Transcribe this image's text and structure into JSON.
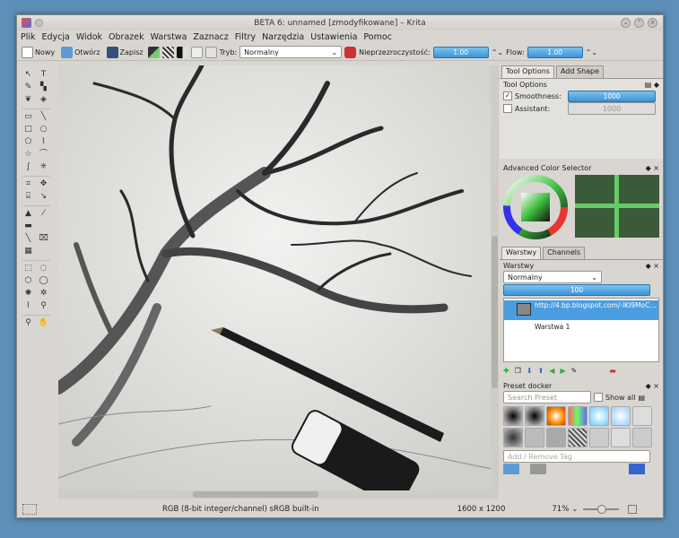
{
  "window": {
    "title": "BETA 6: unnamed [zmodyfikowane] – Krita"
  },
  "menu": [
    "Plik",
    "Edycja",
    "Widok",
    "Obrazek",
    "Warstwa",
    "Zaznacz",
    "Filtry",
    "Narzędzia",
    "Ustawienia",
    "Pomoc"
  ],
  "toolbar": {
    "new_label": "Nowy",
    "open_label": "Otwórz",
    "save_label": "Zapisz",
    "mode_label": "Tryb:",
    "mode_value": "Normalny",
    "opacity_label": "Nieprzezroczystość:",
    "opacity_value": "1.00",
    "flow_label": "Flow:",
    "flow_value": "1.00"
  },
  "tool_options": {
    "tab_active": "Tool Options",
    "tab_inactive": "Add Shape",
    "title": "Tool Options",
    "smoothness_label": "Smoothness:",
    "smoothness_value": "1000",
    "assistant_label": "Assistant:",
    "assistant_value": "1000"
  },
  "color_selector": {
    "title": "Advanced Color Selector"
  },
  "layers": {
    "tab_active": "Warstwy",
    "tab_inactive": "Channels",
    "title": "Warstwy",
    "blend_mode": "Normalny",
    "opacity": "100",
    "items": [
      {
        "name": "http://4.bp.blogspot.com/-lKI9MoC..."
      },
      {
        "name": "Warstwa 1"
      }
    ]
  },
  "preset_docker": {
    "title": "Preset docker",
    "search_placeholder": "Search Preset",
    "show_all_label": "Show all",
    "tag_placeholder": "Add / Remove Tag"
  },
  "status": {
    "color_info": "RGB (8-bit integer/channel)  sRGB built-in",
    "size": "1600 x 1200",
    "zoom": "71%"
  },
  "colors": {
    "selection_blue": "#4a9de0",
    "panel_bg": "#d9d6d2"
  }
}
